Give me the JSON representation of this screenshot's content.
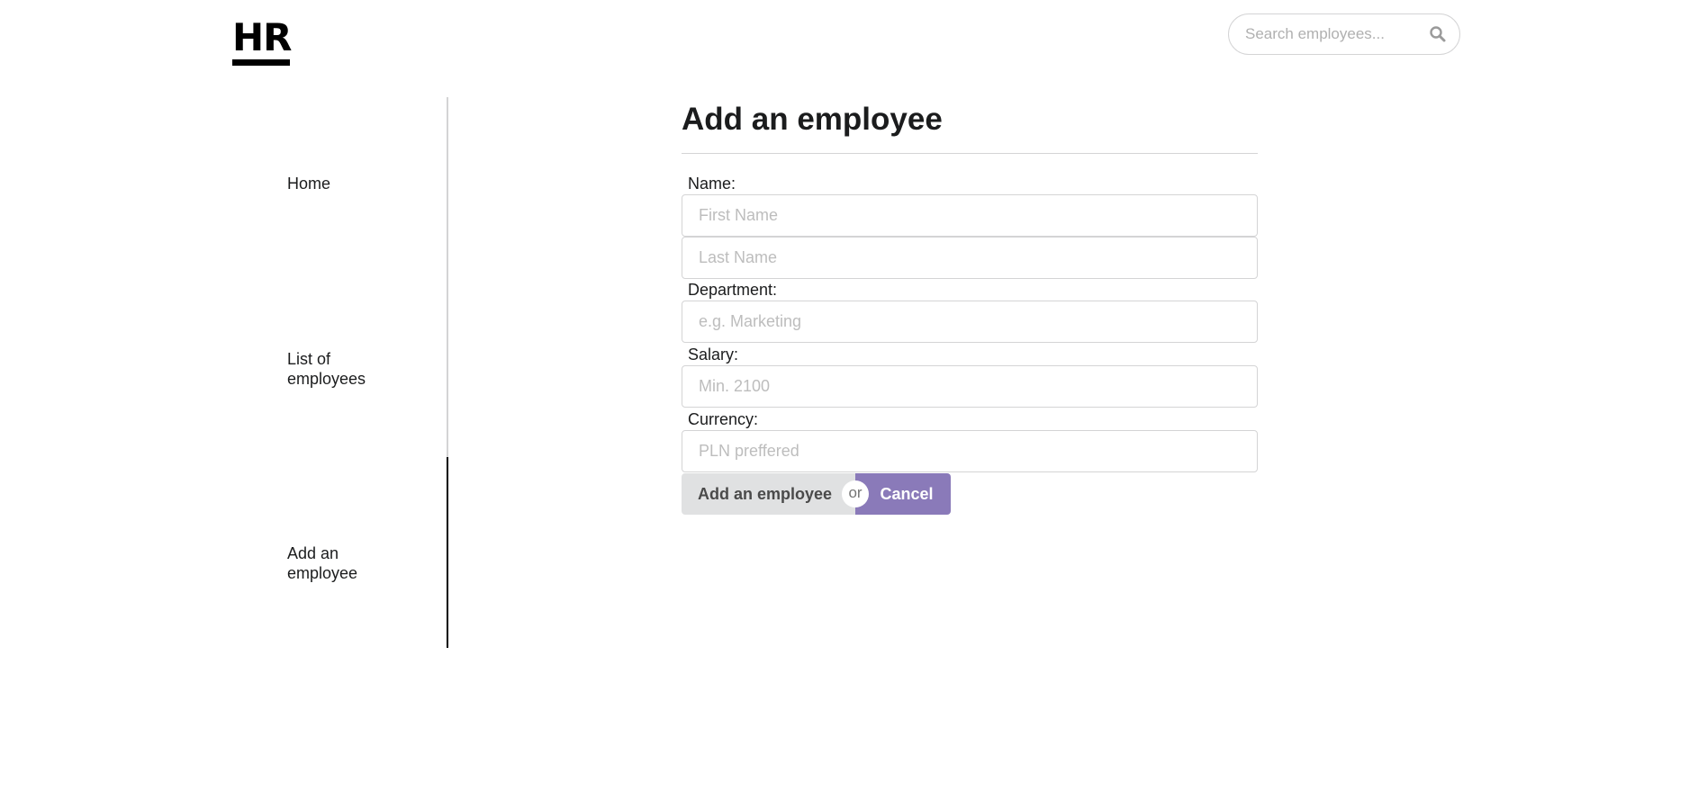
{
  "header": {
    "logo_text": "HR",
    "search": {
      "placeholder": "Search employees...",
      "icon": "search-icon"
    }
  },
  "sidebar": {
    "items": [
      {
        "label": "Home",
        "active": false
      },
      {
        "label": "List of employees",
        "active": false
      },
      {
        "label": "Add an employee",
        "active": true
      }
    ]
  },
  "main": {
    "title": "Add an employee",
    "form": {
      "name_label": "Name:",
      "first_name_placeholder": "First Name",
      "last_name_placeholder": "Last Name",
      "department_label": "Department:",
      "department_placeholder": "e.g. Marketing",
      "salary_label": "Salary:",
      "salary_placeholder": "Min. 2100",
      "currency_label": "Currency:",
      "currency_placeholder": "PLN preffered"
    },
    "buttons": {
      "submit_label": "Add an employee",
      "or_label": "or",
      "cancel_label": "Cancel"
    }
  },
  "colors": {
    "cancel_button": "#8a7ab9",
    "submit_button": "#e0e1e2",
    "active_indicator": "#000000",
    "border": "#d4d4d5"
  }
}
